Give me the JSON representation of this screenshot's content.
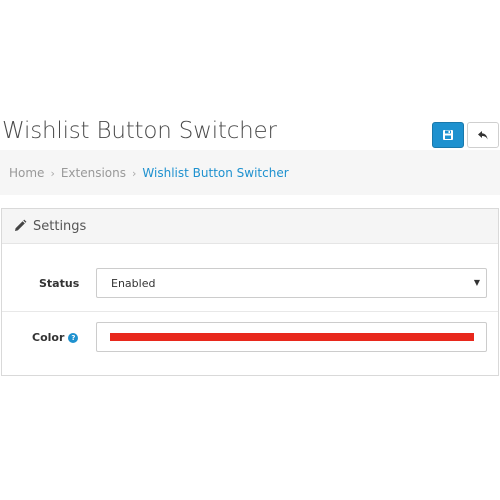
{
  "page": {
    "title": "Wishlist Button Switcher"
  },
  "toolbar": {
    "save_icon": "floppy-disk-icon",
    "back_icon": "reply-arrow-icon",
    "save_color": "#1e91cf"
  },
  "breadcrumb": {
    "items": [
      "Home",
      "Extensions",
      "Wishlist Button Switcher"
    ],
    "separator": "›"
  },
  "panel": {
    "heading_icon": "pencil-icon",
    "heading": "Settings"
  },
  "form": {
    "status": {
      "label": "Status",
      "value": "Enabled",
      "arrow": "▼"
    },
    "color": {
      "label": "Color",
      "help_glyph": "?",
      "value_color": "#e8281c"
    }
  }
}
